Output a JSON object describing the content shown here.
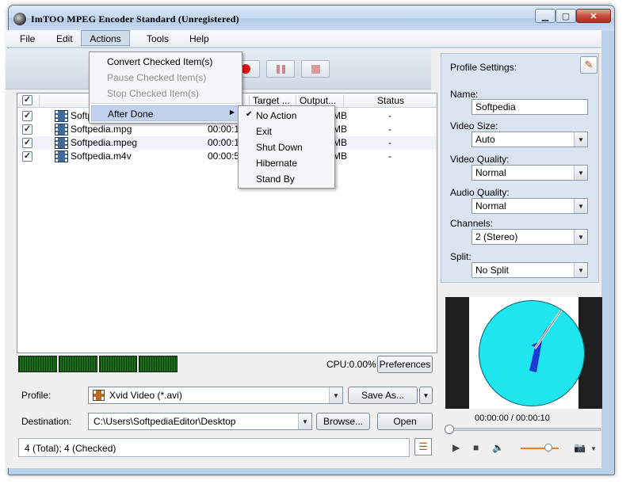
{
  "window": {
    "title": "ImTOO MPEG Encoder Standard (Unregistered)"
  },
  "menu": {
    "file": "File",
    "edit": "Edit",
    "actions": "Actions",
    "tools": "Tools",
    "help": "Help"
  },
  "actions_menu": {
    "convert": "Convert Checked Item(s)",
    "pause": "Pause Checked Item(s)",
    "stop": "Stop Checked Item(s)",
    "after_done": "After Done"
  },
  "after_done_menu": {
    "no_action": "No Action",
    "exit": "Exit",
    "shut_down": "Shut Down",
    "hibernate": "Hibernate",
    "stand_by": "Stand By"
  },
  "list": {
    "headers": {
      "target": "Target ...",
      "output": "Output...",
      "status": "Status"
    },
    "rows": [
      {
        "name": "Softpedia",
        "duration": "",
        "size": "MB",
        "status": "-"
      },
      {
        "name": "Softpedia.mpg",
        "duration": "00:00:12",
        "size": "MB",
        "status": "-"
      },
      {
        "name": "Softpedia.mpeg",
        "duration": "00:00:10",
        "size": "MB",
        "status": "-"
      },
      {
        "name": "Softpedia.m4v",
        "duration": "00:00:53",
        "size": "MB",
        "status": "-"
      }
    ]
  },
  "cpu": "CPU:0.00%",
  "buttons": {
    "preferences": "Preferences",
    "save_as": "Save As...",
    "browse": "Browse...",
    "open": "Open"
  },
  "profile": {
    "label": "Profile:",
    "value": "Xvid Video (*.avi)"
  },
  "destination": {
    "label": "Destination:",
    "value": "C:\\Users\\SoftpediaEditor\\Desktop"
  },
  "status": "4 (Total); 4 (Checked)",
  "profile_settings": {
    "title": "Profile Settings:",
    "name_label": "Name:",
    "name_value": "Softpedia",
    "size_label": "Video Size:",
    "size_value": "Auto",
    "vquality_label": "Video Quality:",
    "vquality_value": "Normal",
    "aquality_label": "Audio Quality:",
    "aquality_value": "Normal",
    "channels_label": "Channels:",
    "channels_value": "2 (Stereo)",
    "split_label": "Split:",
    "split_value": "No Split"
  },
  "preview": {
    "timecode": "00:00:00 / 00:00:10"
  },
  "colors": {
    "record": "#e31212",
    "clock_face": "#1fe6ee",
    "hand": "#1a3ad8",
    "volume": "#e67e22"
  }
}
